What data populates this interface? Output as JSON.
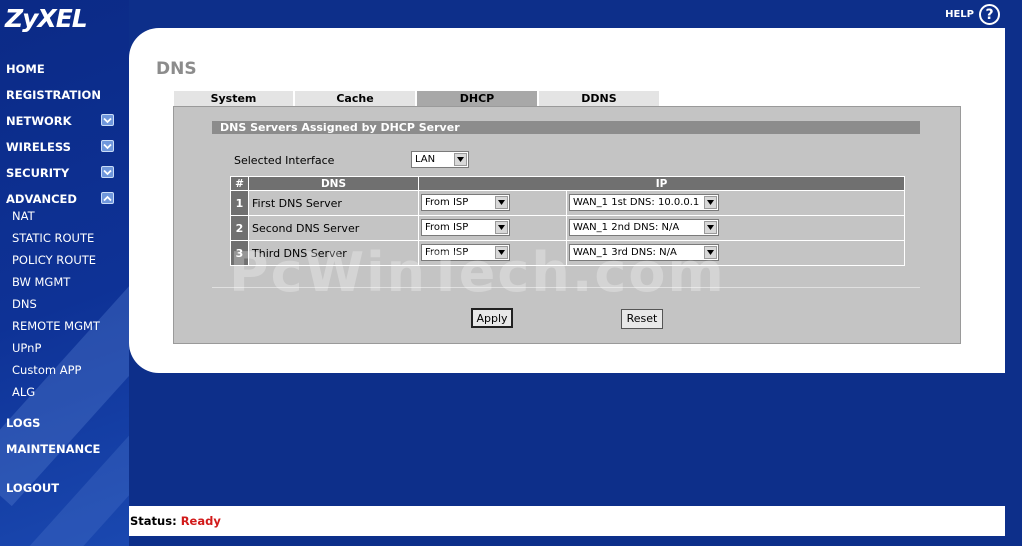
{
  "brand": "ZyXEL",
  "help_label": "HELP",
  "nav": {
    "main": [
      {
        "label": "HOME"
      },
      {
        "label": "REGISTRATION"
      },
      {
        "label": "NETWORK"
      },
      {
        "label": "WIRELESS"
      },
      {
        "label": "SECURITY"
      },
      {
        "label": "ADVANCED"
      },
      {
        "label": "LOGS"
      },
      {
        "label": "MAINTENANCE"
      },
      {
        "label": "LOGOUT"
      }
    ],
    "sub": [
      {
        "label": "NAT"
      },
      {
        "label": "STATIC ROUTE"
      },
      {
        "label": "POLICY ROUTE"
      },
      {
        "label": "BW MGMT"
      },
      {
        "label": "DNS"
      },
      {
        "label": "REMOTE MGMT"
      },
      {
        "label": "UPnP"
      },
      {
        "label": "Custom APP"
      },
      {
        "label": "ALG"
      }
    ]
  },
  "page_title": "DNS",
  "tabs": [
    {
      "label": "System"
    },
    {
      "label": "Cache"
    },
    {
      "label": "DHCP"
    },
    {
      "label": "DDNS"
    }
  ],
  "section_title": "DNS Servers Assigned by DHCP Server",
  "interface": {
    "label": "Selected Interface",
    "value": "LAN"
  },
  "table": {
    "headers": [
      "#",
      "DNS",
      "IP"
    ],
    "rows": [
      {
        "num": "1",
        "name": "First DNS Server",
        "source": "From ISP",
        "ip": "WAN_1 1st DNS: 10.0.0.1"
      },
      {
        "num": "2",
        "name": "Second DNS Server",
        "source": "From ISP",
        "ip": "WAN_1 2nd DNS: N/A"
      },
      {
        "num": "3",
        "name": "Third DNS Server",
        "source": "From ISP",
        "ip": "WAN_1 3rd DNS: N/A"
      }
    ]
  },
  "buttons": {
    "apply": "Apply",
    "reset": "Reset"
  },
  "watermark": "PcWinTech.com",
  "status": {
    "label": "Status:",
    "value": "Ready"
  }
}
